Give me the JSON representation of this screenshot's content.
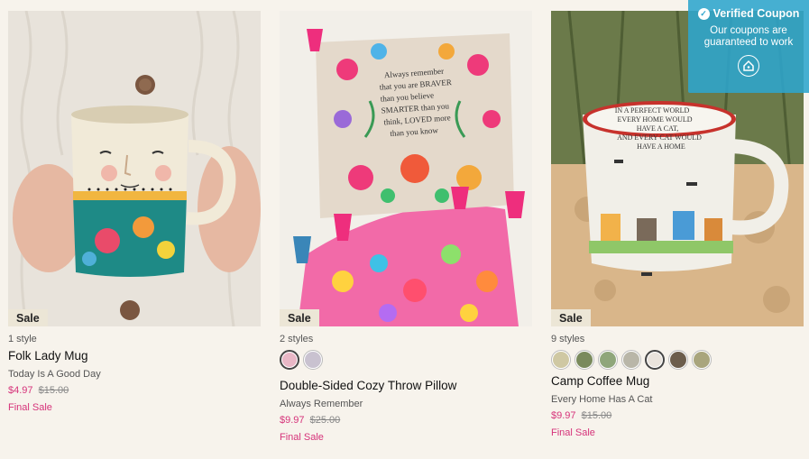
{
  "products": [
    {
      "sale_label": "Sale",
      "styles_count": "1 style",
      "name": "Folk Lady Mug",
      "subtitle": "Today Is A Good Day",
      "price_now": "$4.97",
      "price_was": "$15.00",
      "final_label": "Final Sale",
      "image": "folk-lady-mug-photo"
    },
    {
      "sale_label": "Sale",
      "styles_count": "2 styles",
      "name": "Double-Sided Cozy Throw Pillow",
      "subtitle": "Always Remember",
      "price_now": "$9.97",
      "price_was": "$25.00",
      "final_label": "Final Sale",
      "image": "floral-pillow-photo",
      "swatches": [
        "#e9b7c6",
        "#c9c2d0"
      ]
    },
    {
      "sale_label": "Sale",
      "styles_count": "9 styles",
      "name": "Camp Coffee Mug",
      "subtitle": "Every Home Has A Cat",
      "price_now": "$9.97",
      "price_was": "$15.00",
      "final_label": "Final Sale",
      "image": "camp-coffee-mug-photo",
      "swatches": [
        "#cfc8a3",
        "#7a8a5c",
        "#8fa67a",
        "#b9b6a8",
        "#e9e3dc",
        "#6c5d4c",
        "#a9a57d"
      ]
    }
  ],
  "coupon": {
    "title": "Verified Coupon",
    "message": "Our coupons are guaranteed to work",
    "icon": "home-tag-icon",
    "color": "#2da5cd"
  },
  "colors": {
    "accent_pink": "#d6337a",
    "background": "#f7f3ec",
    "sale_tag_bg": "#ece6d6"
  }
}
